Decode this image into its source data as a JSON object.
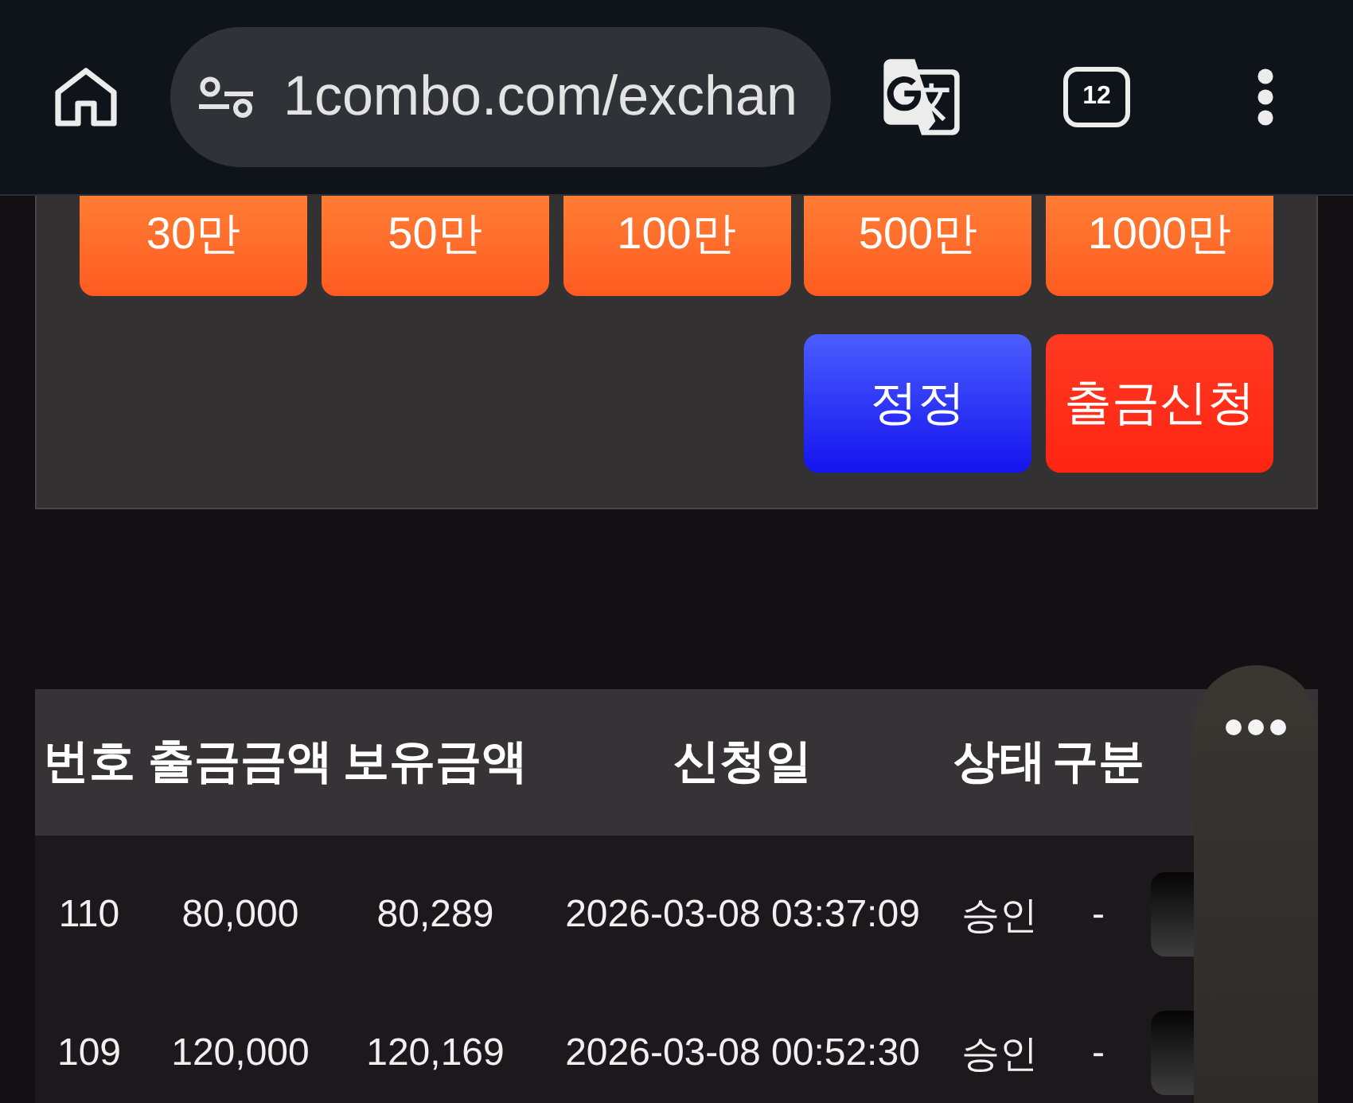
{
  "browser": {
    "url": "1combo.com/exchan",
    "tab_count": "12"
  },
  "amount_buttons": [
    "30만",
    "50만",
    "100만",
    "500만",
    "1000만"
  ],
  "action_buttons": [
    {
      "label": "정정",
      "kind": "correct"
    },
    {
      "label": "출금신청",
      "kind": "request"
    }
  ],
  "table": {
    "columns": [
      "번호",
      "출금금액",
      "보유금액",
      "신청일",
      "상태",
      "구분"
    ],
    "rows": [
      {
        "cells": [
          "110",
          "80,000",
          "80,289",
          "2026-03-08 03:37:09",
          "승인",
          "-"
        ]
      },
      {
        "cells": [
          "109",
          "120,000",
          "120,169",
          "2026-03-08 00:52:30",
          "승인",
          "-"
        ]
      }
    ]
  }
}
